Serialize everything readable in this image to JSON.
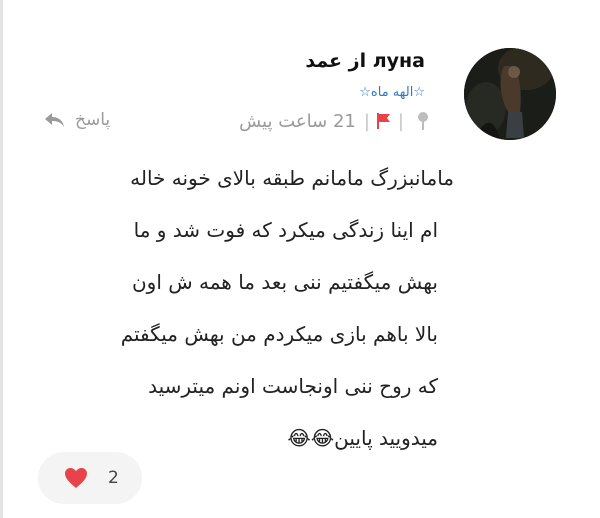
{
  "post": {
    "author": {
      "name": "луна",
      "prefix": "از",
      "suffix": "عمد",
      "community": "☆الهه ماه☆"
    },
    "meta": {
      "time_ago": "21 ساعت پیش"
    },
    "reply_label": "پاسخ",
    "body_lines": [
      "مامانبزرگ مامانم طبقه بالای خونه خاله",
      "ام اینا زندگی میکرد که فوت شد و ما",
      "بهش میگفتیم ننی بعد ما همه ش اون",
      "بالا باهم بازی میکردم من بهش میگفتم",
      "که روح ننی اونجاست اونم میترسید",
      "میدویید پایین😂😂"
    ],
    "likes": {
      "count": "2"
    }
  },
  "icons": {
    "pin": "pin-icon",
    "flag": "flag-icon",
    "reply": "reply-arrow-icon",
    "heart": "heart-icon"
  },
  "colors": {
    "community": "#2f78c4",
    "flag": "#e8434b",
    "heart": "#e8434b",
    "meta": "#9a9a9a"
  }
}
